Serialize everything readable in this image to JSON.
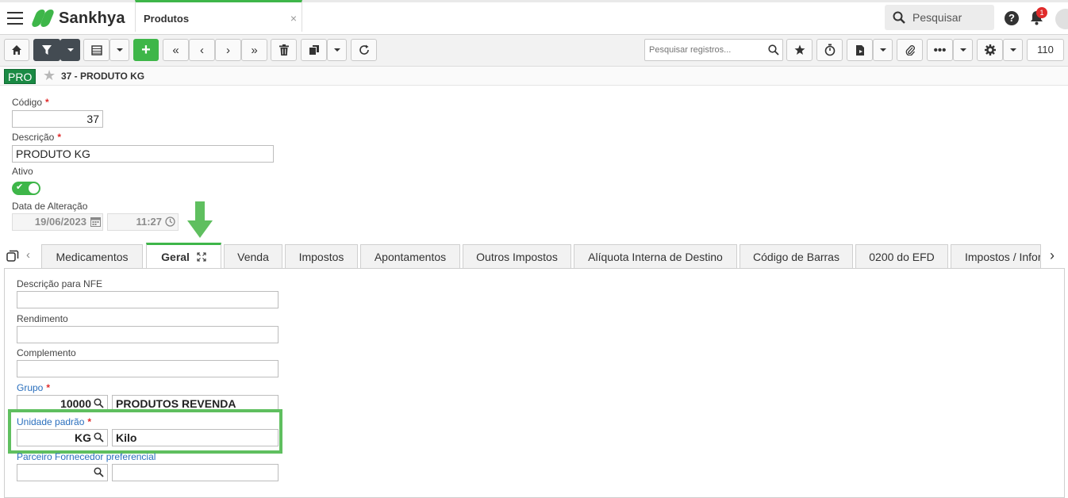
{
  "topbar": {
    "brand": "Sankhya",
    "app_tab": "Produtos",
    "close_glyph": "×",
    "search_label": "Pesquisar",
    "help_glyph": "?",
    "notifications_count": "1"
  },
  "toolbar": {
    "add_glyph": "+",
    "records_search_placeholder": "Pesquisar registros...",
    "record_count": "110"
  },
  "breadcrumb": {
    "tag": "PRO",
    "title": "37 - PRODUTO KG"
  },
  "form": {
    "codigo_label": "Código",
    "codigo_value": "37",
    "descricao_label": "Descrição",
    "descricao_value": "PRODUTO KG",
    "ativo_label": "Ativo",
    "ativo_value": true,
    "data_alteracao_label": "Data de Alteração",
    "data_value": "19/06/2023",
    "hora_value": "11:27",
    "required_mark": "*"
  },
  "tabs": [
    {
      "label": "Medicamentos"
    },
    {
      "label": "Geral"
    },
    {
      "label": "Venda"
    },
    {
      "label": "Impostos"
    },
    {
      "label": "Apontamentos"
    },
    {
      "label": "Outros Impostos"
    },
    {
      "label": "Alíquota Interna de Destino"
    },
    {
      "label": "Código de Barras"
    },
    {
      "label": "0200 do EFD"
    },
    {
      "label": "Impostos / Infor"
    }
  ],
  "geral": {
    "descricao_nfe_label": "Descrição para NFE",
    "descricao_nfe_value": "",
    "rendimento_label": "Rendimento",
    "rendimento_value": "",
    "complemento_label": "Complemento",
    "complemento_value": "",
    "grupo_label": "Grupo",
    "grupo_code": "10000",
    "grupo_desc": "PRODUTOS REVENDA",
    "unidade_label": "Unidade padrão",
    "unidade_code": "KG",
    "unidade_desc": "Kilo",
    "parceiro_label": "Parceiro Fornecedor preferencial",
    "parceiro_code": "",
    "parceiro_desc": ""
  },
  "colors": {
    "accent": "#3eb649",
    "toolbar_dark": "#434b52",
    "link": "#2a6fbd",
    "required": "#e02b2b",
    "highlight": "#5fbf5f"
  }
}
